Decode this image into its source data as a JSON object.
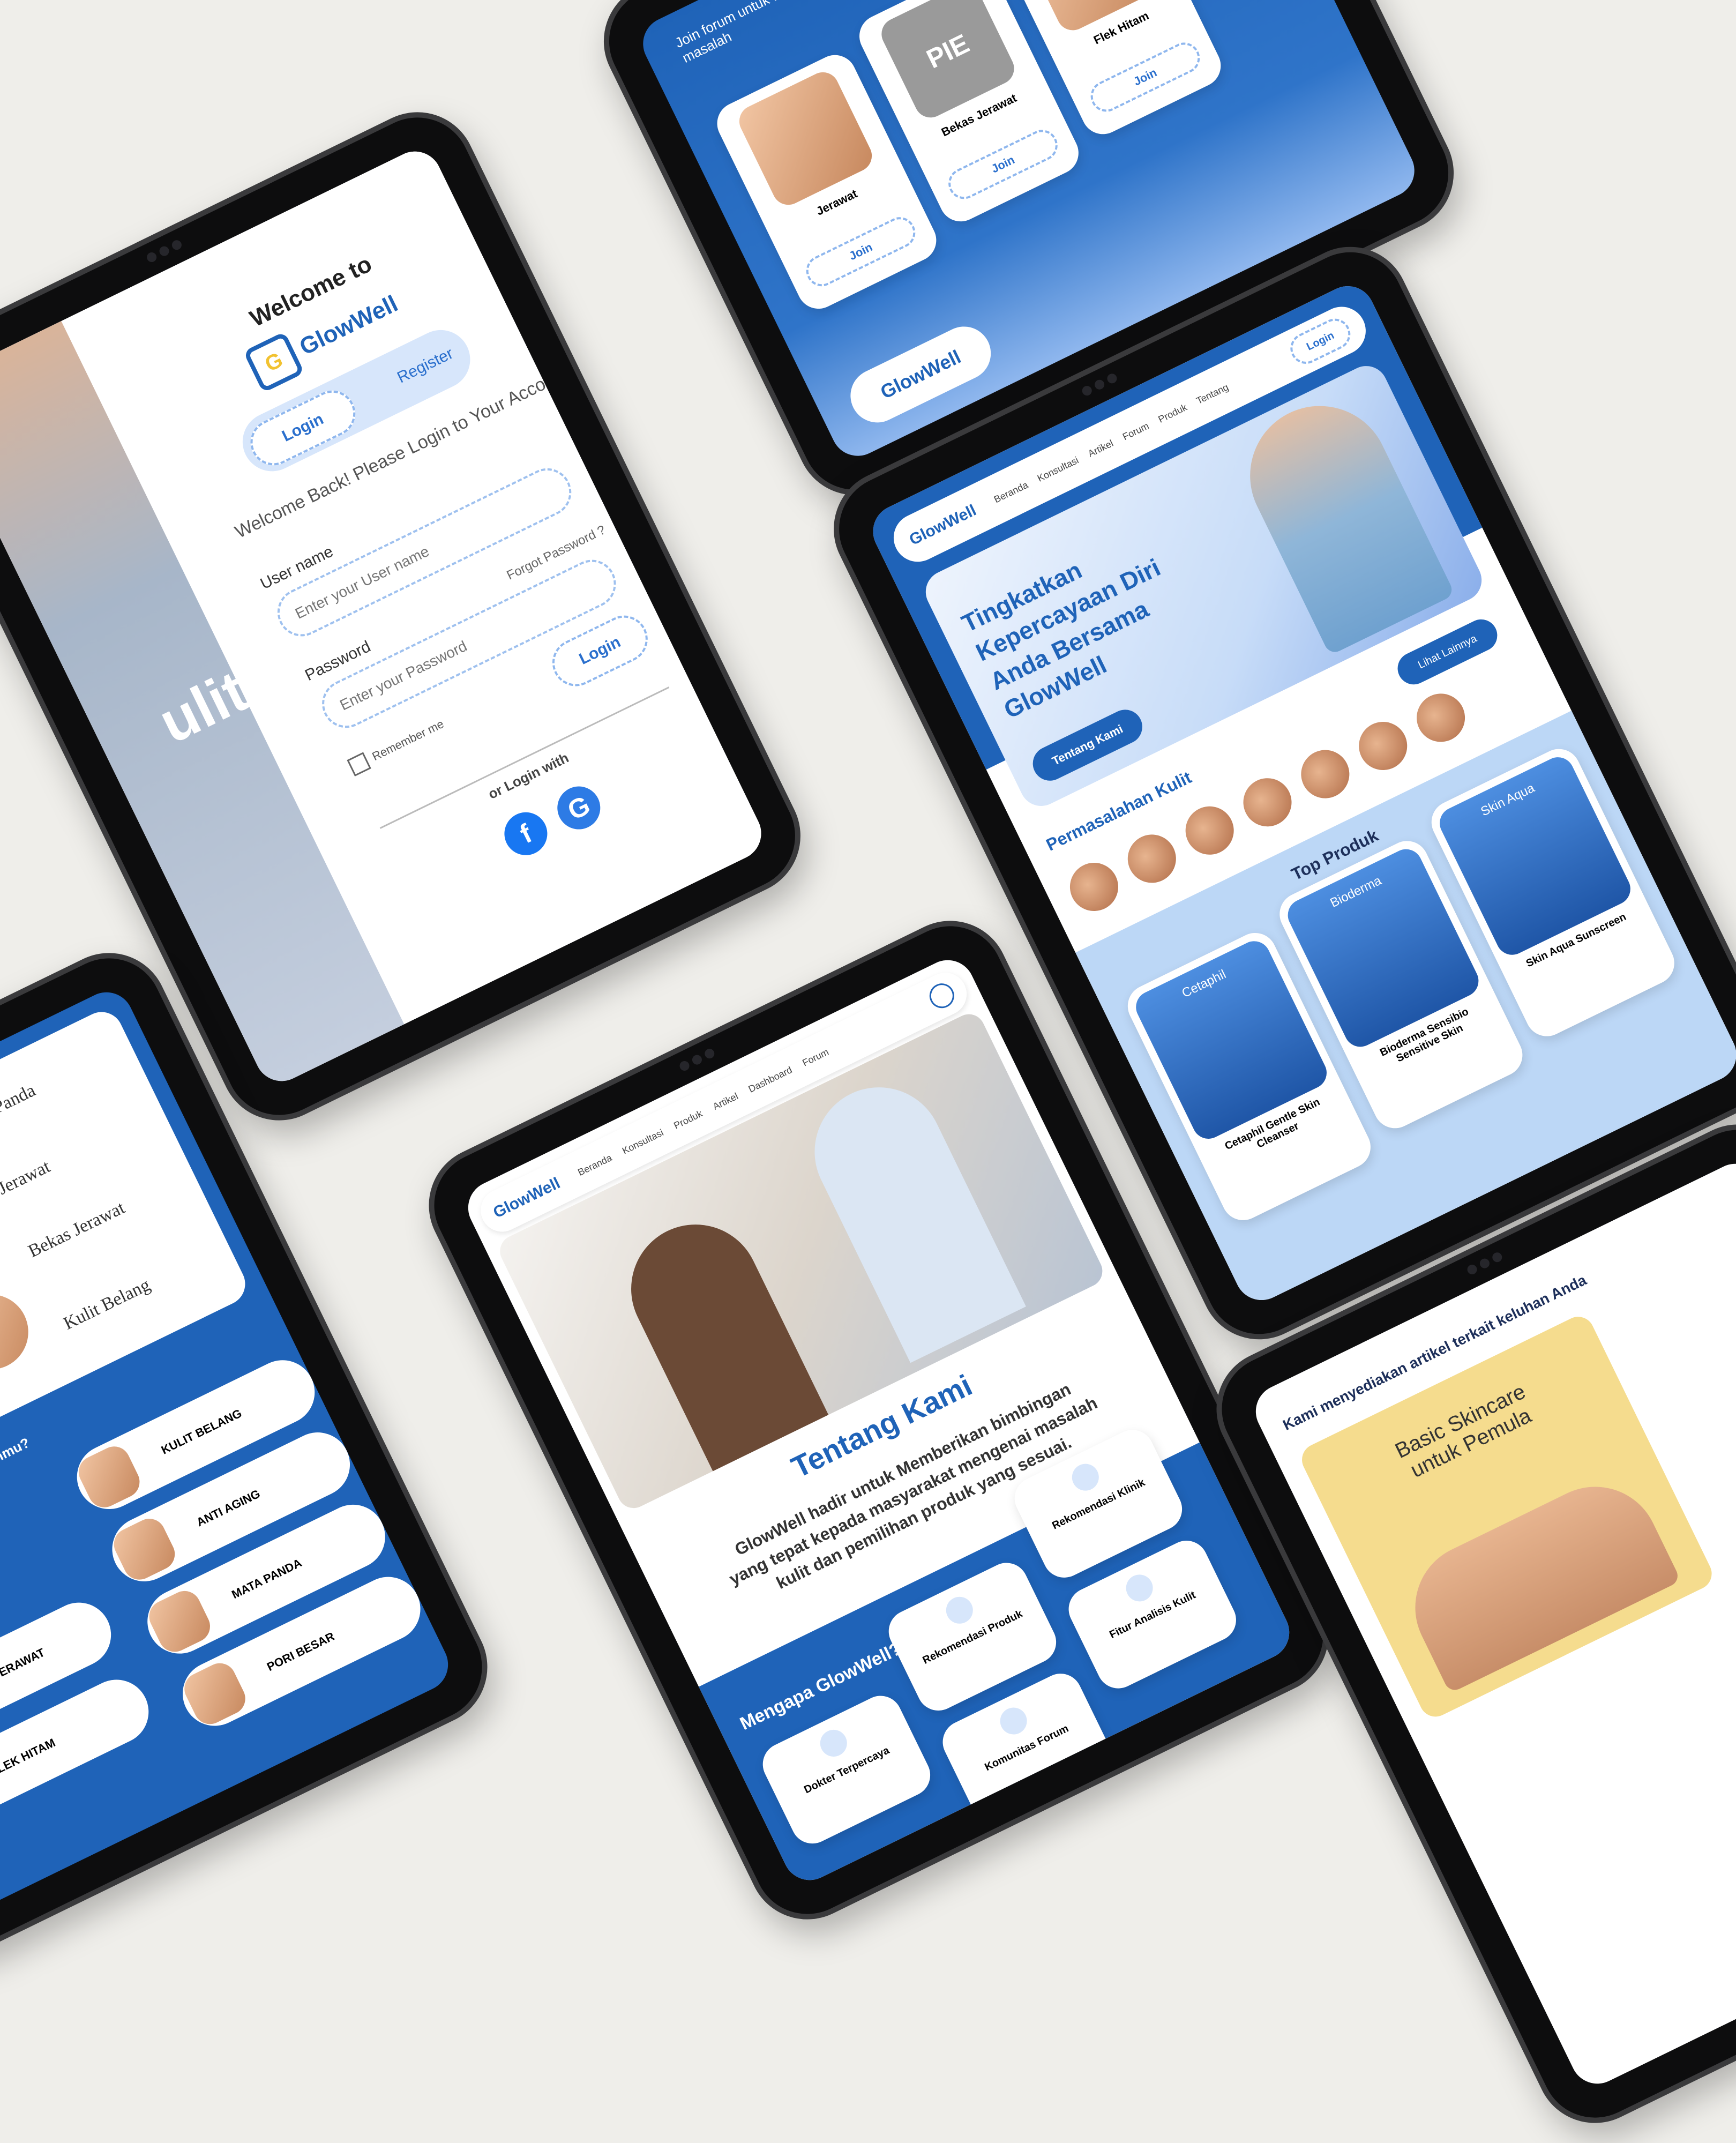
{
  "login": {
    "welcome": "Welcome to",
    "brand": "GlowWell",
    "tab_login": "Login",
    "tab_register": "Register",
    "heading": "Welcome Back! Please Login to Your Account",
    "username_label": "User name",
    "username_placeholder": "Enter your User name",
    "password_label": "Password",
    "password_placeholder": "Enter your Password",
    "forgot": "Forgot Password ?",
    "remember": "Remember me",
    "login_button": "Login",
    "or_login_with": "or Login with",
    "side_text": "ulit"
  },
  "home": {
    "brand": "GlowWell",
    "nav": [
      "Beranda",
      "Konsultasi",
      "Artikel",
      "Forum",
      "Produk",
      "Tentang"
    ],
    "login_button": "Login",
    "hero_title": "Tingkatkan Kepercayaan Diri Anda Bersama GlowWell",
    "hero_button": "Tentang Kami",
    "section_problems": "Permasalahan Kulit",
    "view_all": "Lihat Lainnya",
    "section_products": "Top Produk",
    "products": [
      "Cetaphil Gentle Skin Cleanser",
      "Bioderma Sensibio Sensitive Skin",
      "Skin Aqua Sunscreen"
    ],
    "brand_tags": [
      "Cetaphil",
      "Bioderma",
      "Skin Aqua"
    ]
  },
  "about": {
    "brand": "GlowWell",
    "nav": [
      "Beranda",
      "Konsultasi",
      "Produk",
      "Artikel",
      "Dashboard",
      "Forum"
    ],
    "title": "Tentang Kami",
    "body": "GlowWell hadir untuk Memberikan bimbingan yang tepat kepada masyarakat mengenai masalah kulit dan pemilihan produk yang sesuai.",
    "why": "Mengapa GlowWell?",
    "features": [
      "Dokter Terpercaya",
      "Rekomendasi Produk",
      "Rekomendasi Klinik",
      "Komunitas Forum",
      "Fitur Analisis Kulit"
    ]
  },
  "skin": {
    "labels": [
      "Mata Panda",
      "Jerawat",
      "Bekas Jerawat",
      "Kulit Belang"
    ],
    "question": "Apa Keluhanmu?",
    "items": [
      "KULIT BELANG",
      "ANTI AGING",
      "MATA PANDA",
      "PORI BESAR",
      "BEKAS JERAWAT",
      "FLEK HITAM"
    ]
  },
  "community": {
    "intro": "Join forum untuk Diskusi komunitas yang memiliki masalah",
    "cards": [
      "Jerawat",
      "Bekas Jerawat",
      "Flek Hitam"
    ],
    "join": "Join",
    "brand": "GlowWell",
    "badge": "PIE"
  },
  "article": {
    "intro": "Kami menyediakan artikel terkait keluhan Anda",
    "card_title": "Basic Skincare untuk Pemula"
  },
  "colors": {
    "primary": "#1f63b8",
    "light": "#bcd7f6",
    "accent": "#f2c230",
    "background": "#efeeea"
  }
}
